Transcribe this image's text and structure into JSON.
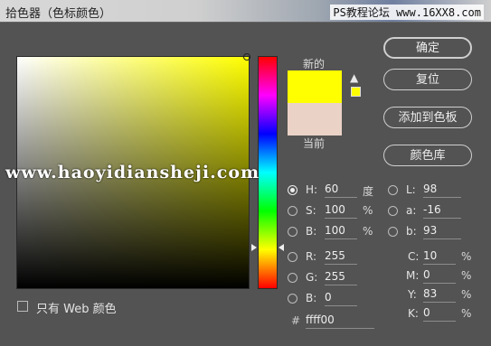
{
  "window": {
    "title": "拾色器（色标颜色）",
    "watermark_top": "PS教程论坛 www.16XX8.com"
  },
  "swatches": {
    "new_label": "新的",
    "current_label": "当前",
    "new_color": "#ffff00",
    "current_color": "#ead2c7",
    "warning_icon": "warning-triangle-icon"
  },
  "buttons": {
    "ok": "确定",
    "reset": "复位",
    "add_to_swatches": "添加到色板",
    "color_libraries": "颜色库"
  },
  "hsb": [
    {
      "key": "H",
      "label": "H:",
      "value": "60",
      "unit": "度",
      "selected": true
    },
    {
      "key": "S",
      "label": "S:",
      "value": "100",
      "unit": "%",
      "selected": false
    },
    {
      "key": "B",
      "label": "B:",
      "value": "100",
      "unit": "%",
      "selected": false
    }
  ],
  "rgb": [
    {
      "key": "R",
      "label": "R:",
      "value": "255"
    },
    {
      "key": "G",
      "label": "G:",
      "value": "255"
    },
    {
      "key": "B",
      "label": "B:",
      "value": "0"
    }
  ],
  "lab": [
    {
      "key": "L",
      "label": "L:",
      "value": "98"
    },
    {
      "key": "a",
      "label": "a:",
      "value": "-16"
    },
    {
      "key": "b",
      "label": "b:",
      "value": "93"
    }
  ],
  "cmyk": [
    {
      "key": "C",
      "label": "C:",
      "value": "10",
      "unit": "%"
    },
    {
      "key": "M",
      "label": "M:",
      "value": "0",
      "unit": "%"
    },
    {
      "key": "Y",
      "label": "Y:",
      "value": "83",
      "unit": "%"
    },
    {
      "key": "K",
      "label": "K:",
      "value": "0",
      "unit": "%"
    }
  ],
  "hex": {
    "label": "#",
    "value": "ffff00"
  },
  "web_only": {
    "label": "只有 Web 颜色",
    "checked": false
  },
  "watermark_mid": "www.haoyidiansheji.com",
  "colors": {
    "dialog_bg": "#535353",
    "hue_base": "#ffff00"
  }
}
